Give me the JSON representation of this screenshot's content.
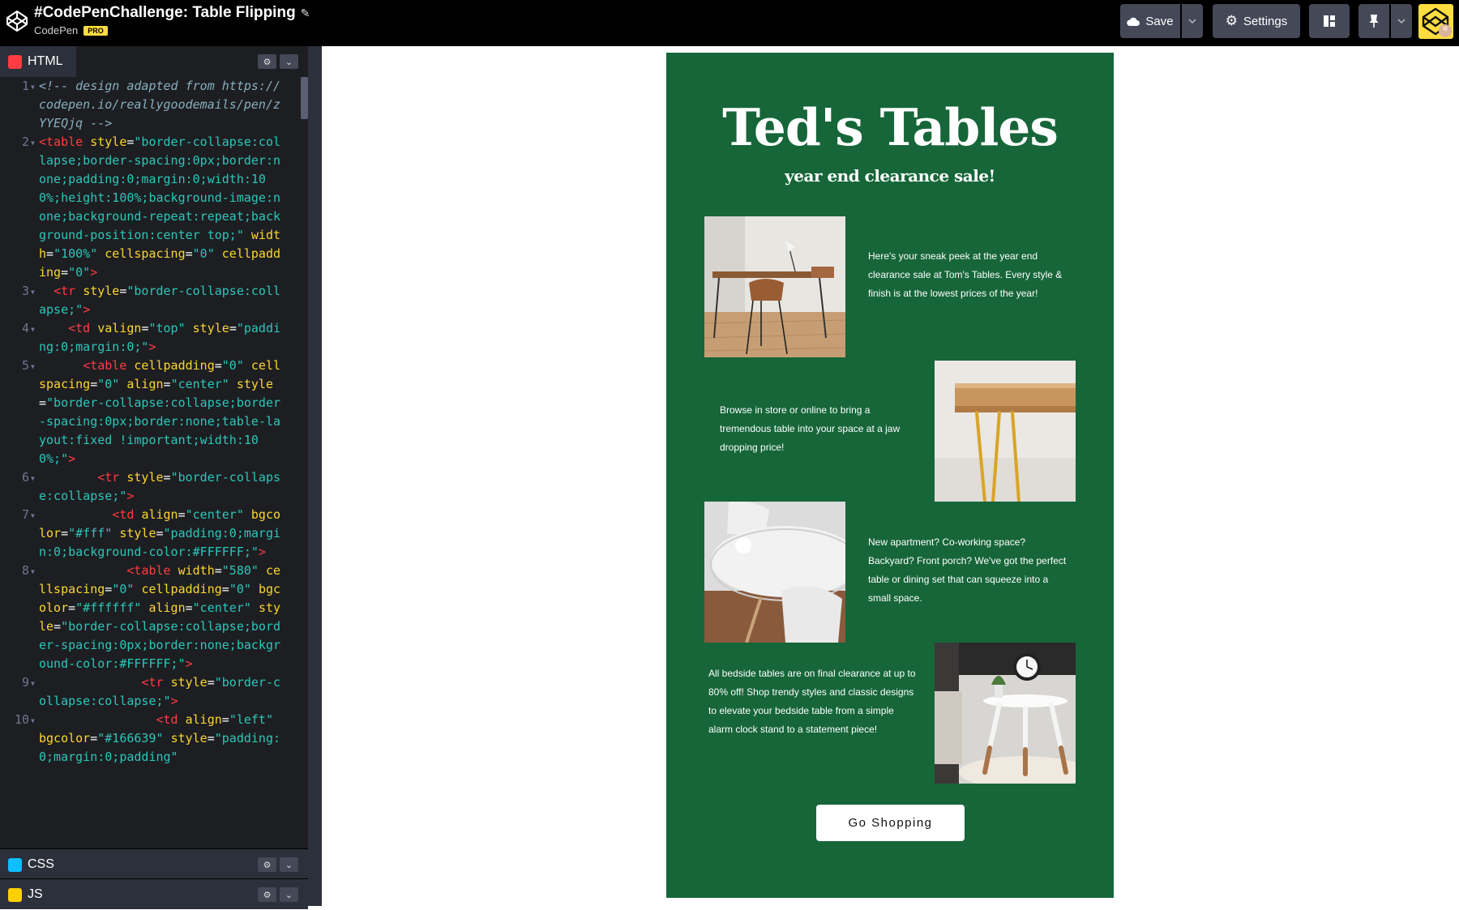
{
  "topbar": {
    "title": "#CodePenChallenge: Table Flipping",
    "owner": "CodePen",
    "badge": "PRO",
    "save_label": "Save",
    "settings_label": "Settings"
  },
  "editor": {
    "html_tab": "HTML",
    "css_tab": "CSS",
    "js_tab": "JS",
    "code_lines": [
      {
        "n": "1",
        "parts": [
          [
            "c-com",
            "<!-- design adapted from https://codepen.io/reallygoodemails/pen/zYYEQjq -->"
          ]
        ]
      },
      {
        "n": "2",
        "parts": [
          [
            "c-tag",
            "<table "
          ],
          [
            "c-attr",
            "style"
          ],
          [
            "",
            "="
          ],
          [
            "c-str",
            "\"border-collapse:collapse;border-spacing:0px;border:none;padding:0;margin:0;width:100%;height:100%;background-image:none;background-repeat:repeat;background-position:center top;\""
          ],
          [
            "",
            " "
          ],
          [
            "c-attr",
            "width"
          ],
          [
            "",
            "="
          ],
          [
            "c-str",
            "\"100%\""
          ],
          [
            "",
            " "
          ],
          [
            "c-attr",
            "cellspacing"
          ],
          [
            "",
            "="
          ],
          [
            "c-str",
            "\"0\""
          ],
          [
            "",
            " "
          ],
          [
            "c-attr",
            "cellpadding"
          ],
          [
            "",
            "="
          ],
          [
            "c-str",
            "\"0\""
          ],
          [
            "c-tag",
            ">"
          ]
        ]
      },
      {
        "n": "3",
        "parts": [
          [
            "c-tag",
            "  <tr "
          ],
          [
            "c-attr",
            "style"
          ],
          [
            "",
            "="
          ],
          [
            "c-str",
            "\"border-collapse:collapse;\""
          ],
          [
            "c-tag",
            ">"
          ]
        ]
      },
      {
        "n": "4",
        "parts": [
          [
            "c-tag",
            "    <td "
          ],
          [
            "c-attr",
            "valign"
          ],
          [
            "",
            "="
          ],
          [
            "c-str",
            "\"top\""
          ],
          [
            "",
            " "
          ],
          [
            "c-attr",
            "style"
          ],
          [
            "",
            "="
          ],
          [
            "c-str",
            "\"padding:0;margin:0;\""
          ],
          [
            "c-tag",
            ">"
          ]
        ]
      },
      {
        "n": "5",
        "parts": [
          [
            "c-tag",
            "      <table "
          ],
          [
            "c-attr",
            "cellpadding"
          ],
          [
            "",
            "="
          ],
          [
            "c-str",
            "\"0\""
          ],
          [
            "",
            " "
          ],
          [
            "c-attr",
            "cellspacing"
          ],
          [
            "",
            "="
          ],
          [
            "c-str",
            "\"0\""
          ],
          [
            "",
            " "
          ],
          [
            "c-attr",
            "align"
          ],
          [
            "",
            "="
          ],
          [
            "c-str",
            "\"center\""
          ],
          [
            "",
            " "
          ],
          [
            "c-attr",
            "style"
          ],
          [
            "",
            "="
          ],
          [
            "c-str",
            "\"border-collapse:collapse;border-spacing:0px;border:none;table-layout:fixed !important;width:100%;\""
          ],
          [
            "c-tag",
            ">"
          ]
        ]
      },
      {
        "n": "6",
        "parts": [
          [
            "c-tag",
            "        <tr "
          ],
          [
            "c-attr",
            "style"
          ],
          [
            "",
            "="
          ],
          [
            "c-str",
            "\"border-collapse:collapse;\""
          ],
          [
            "c-tag",
            ">"
          ]
        ]
      },
      {
        "n": "7",
        "parts": [
          [
            "c-tag",
            "          <td "
          ],
          [
            "c-attr",
            "align"
          ],
          [
            "",
            "="
          ],
          [
            "c-str",
            "\"center\""
          ],
          [
            "",
            " "
          ],
          [
            "c-attr",
            "bgcolor"
          ],
          [
            "",
            "="
          ],
          [
            "c-str",
            "\"#fff\""
          ],
          [
            "",
            " "
          ],
          [
            "c-attr",
            "style"
          ],
          [
            "",
            "="
          ],
          [
            "c-str",
            "\"padding:0;margin:0;background-color:#FFFFFF;\""
          ],
          [
            "c-tag",
            ">"
          ]
        ]
      },
      {
        "n": "8",
        "parts": [
          [
            "c-tag",
            "            <table "
          ],
          [
            "c-attr",
            "width"
          ],
          [
            "",
            "="
          ],
          [
            "c-str",
            "\"580\""
          ],
          [
            "",
            " "
          ],
          [
            "c-attr",
            "cellspacing"
          ],
          [
            "",
            "="
          ],
          [
            "c-str",
            "\"0\""
          ],
          [
            "",
            " "
          ],
          [
            "c-attr",
            "cellpadding"
          ],
          [
            "",
            "="
          ],
          [
            "c-str",
            "\"0\""
          ],
          [
            "",
            " "
          ],
          [
            "c-attr",
            "bgcolor"
          ],
          [
            "",
            "="
          ],
          [
            "c-str",
            "\"#ffffff\""
          ],
          [
            "",
            " "
          ],
          [
            "c-attr",
            "align"
          ],
          [
            "",
            "="
          ],
          [
            "c-str",
            "\"center\""
          ],
          [
            "",
            " "
          ],
          [
            "c-attr",
            "style"
          ],
          [
            "",
            "="
          ],
          [
            "c-str",
            "\"border-collapse:collapse;border-spacing:0px;border:none;background-color:#FFFFFF;\""
          ],
          [
            "c-tag",
            ">"
          ]
        ]
      },
      {
        "n": "9",
        "parts": [
          [
            "c-tag",
            "              <tr "
          ],
          [
            "c-attr",
            "style"
          ],
          [
            "",
            "="
          ],
          [
            "c-str",
            "\"border-collapse:collapse;\""
          ],
          [
            "c-tag",
            ">"
          ]
        ]
      },
      {
        "n": "10",
        "parts": [
          [
            "c-tag",
            "                <td "
          ],
          [
            "c-attr",
            "align"
          ],
          [
            "",
            "="
          ],
          [
            "c-str",
            "\"left\""
          ],
          [
            "",
            " "
          ],
          [
            "c-attr",
            "bgcolor"
          ],
          [
            "",
            "="
          ],
          [
            "c-str",
            "\"#166639\""
          ],
          [
            "",
            " "
          ],
          [
            "c-attr",
            "style"
          ],
          [
            "",
            "="
          ],
          [
            "c-str",
            "\"padding:0;margin:0;padding\""
          ]
        ]
      }
    ]
  },
  "email": {
    "bg_color": "#166639",
    "title": "Ted's Tables",
    "subtitle": "year end clearance sale!",
    "paragraphs": [
      "Here's your sneak peek at the year end clearance sale at Tom's Tables. Every style & finish is at the lowest prices of the year!",
      "Browse in store or online to bring a tremendous table into your space at a jaw dropping price!",
      "New apartment? Co-working space? Backyard? Front porch? We've got the perfect table or dining set that can squeeze into a small space.",
      "All bedside tables are on final clearance at up to 80% off! Shop trendy styles and classic designs to elevate your bedside table from a simple alarm clock stand to a statement piece!"
    ],
    "cta_label": "Go Shopping"
  }
}
